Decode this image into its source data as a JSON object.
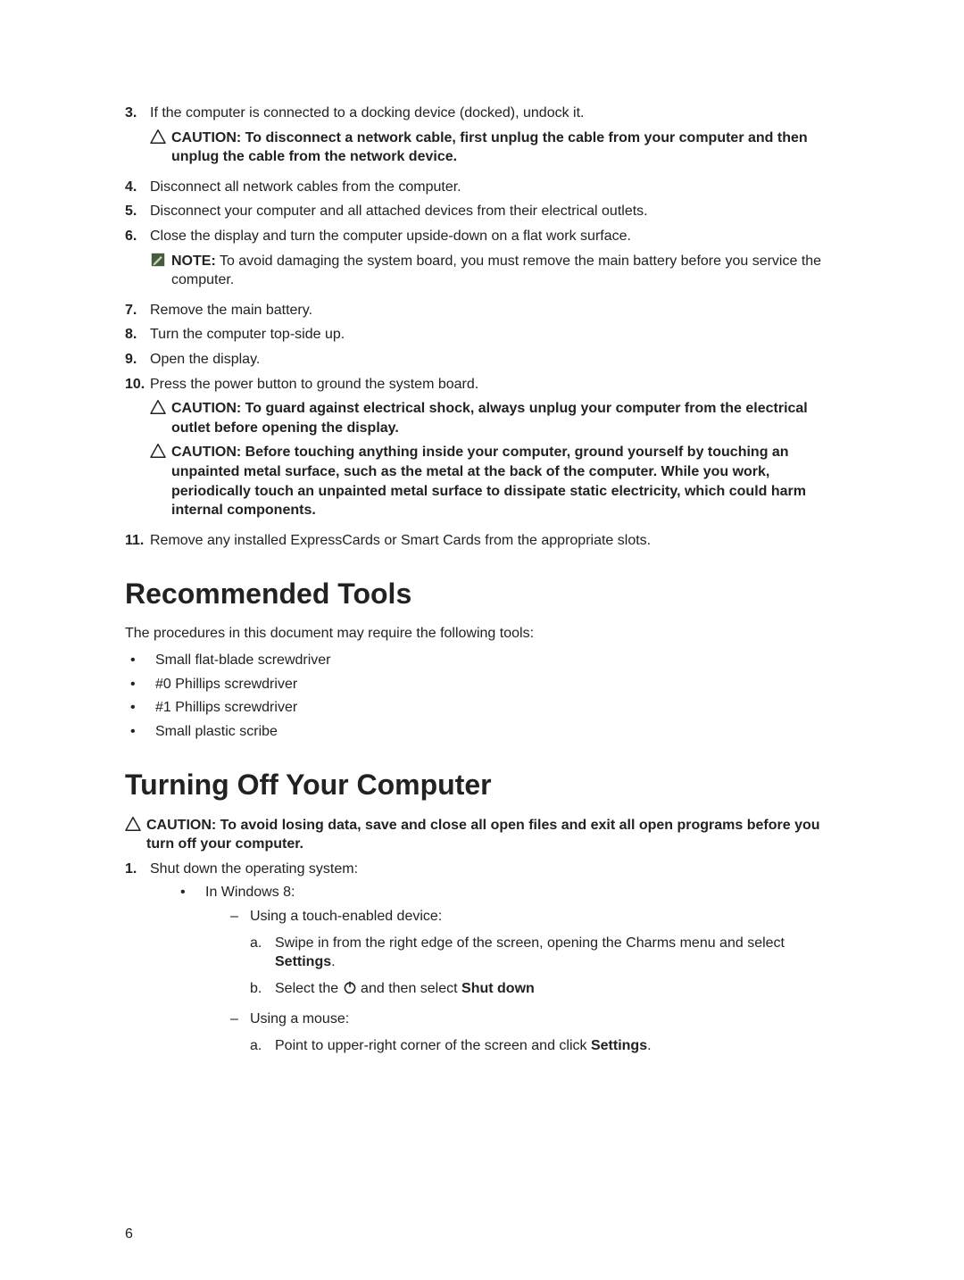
{
  "steps": {
    "s3": "If the computer is connected to a docking device (docked), undock it.",
    "s3_caution": "CAUTION: To disconnect a network cable, first unplug the cable from your computer and then unplug the cable from the network device.",
    "s4": "Disconnect all network cables from the computer.",
    "s5": "Disconnect your computer and all attached devices from their electrical outlets.",
    "s6": "Close the display and turn the computer upside-down on a flat work surface.",
    "s6_note_label": "NOTE:",
    "s6_note_body": " To avoid damaging the system board, you must remove the main battery before you service the computer.",
    "s7": "Remove the main battery.",
    "s8": "Turn the computer top-side up.",
    "s9": "Open the display.",
    "s10": "Press the power button to ground the system board.",
    "s10_caution1": "CAUTION: To guard against electrical shock, always unplug your computer from the electrical outlet before opening the display.",
    "s10_caution2": "CAUTION: Before touching anything inside your computer, ground yourself by touching an unpainted metal surface, such as the metal at the back of the computer. While you work, periodically touch an unpainted metal surface to dissipate static electricity, which could harm internal components.",
    "s11": "Remove any installed ExpressCards or Smart Cards from the appropriate slots."
  },
  "nums": {
    "n3": "3.",
    "n4": "4.",
    "n5": "5.",
    "n6": "6.",
    "n7": "7.",
    "n8": "8.",
    "n9": "9.",
    "n10": "10.",
    "n11": "11.",
    "n1b": "1."
  },
  "tools": {
    "heading": "Recommended Tools",
    "intro": "The procedures in this document may require the following tools:",
    "t1": "Small flat-blade screwdriver",
    "t2": "#0 Phillips screwdriver",
    "t3": "#1 Phillips screwdriver",
    "t4": "Small plastic scribe"
  },
  "turnoff": {
    "heading": "Turning Off Your Computer",
    "caution": "CAUTION: To avoid losing data, save and close all open files and exit all open programs before you turn off your computer.",
    "step1": "Shut down the operating system:",
    "win8": "In Windows 8:",
    "touch": "Using a touch-enabled device:",
    "touch_a": "Swipe in from the right edge of the screen, opening the Charms menu and select ",
    "touch_a_bold": "Settings",
    "touch_a_end": ".",
    "touch_b_pre": "Select the  ",
    "touch_b_mid": " and then select ",
    "touch_b_bold": "Shut down",
    "mouse": "Using a mouse:",
    "mouse_a": "Point to upper-right corner of the screen and click ",
    "mouse_a_bold": "Settings",
    "mouse_a_end": "."
  },
  "letters": {
    "a": "a.",
    "b": "b."
  },
  "page": "6"
}
